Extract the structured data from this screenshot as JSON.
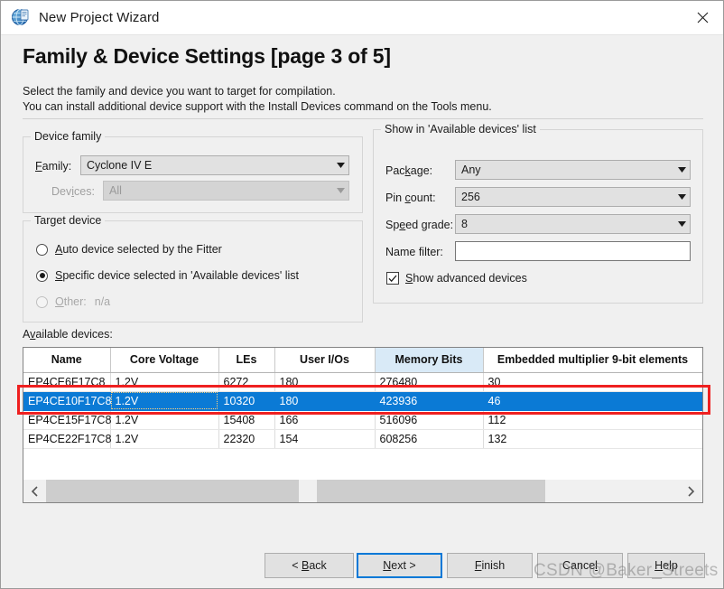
{
  "window": {
    "title": "New Project Wizard",
    "icon": "quartus-globe-icon",
    "close_label": "✕"
  },
  "header": {
    "page_title": "Family & Device Settings [page 3 of 5]",
    "description_line1": "Select the family and device you want to target for compilation.",
    "description_line2": "You can install additional device support with the Install Devices command on the Tools menu."
  },
  "device_family": {
    "legend": "Device family",
    "family_label": "Family:",
    "family_value": "Cyclone IV E",
    "devices_label": "Devices:",
    "devices_value": "All"
  },
  "target_device": {
    "legend": "Target device",
    "options": [
      {
        "label": "Auto device selected by the Fitter",
        "checked": false,
        "disabled": false
      },
      {
        "label": "Specific device selected in 'Available devices' list",
        "checked": true,
        "disabled": false
      },
      {
        "label": "Other:",
        "value": "n/a",
        "checked": false,
        "disabled": true
      }
    ]
  },
  "show_list": {
    "legend": "Show in 'Available devices' list",
    "package_label": "Package:",
    "package_value": "Any",
    "pin_count_label": "Pin count:",
    "pin_count_value": "256",
    "speed_grade_label": "Speed grade:",
    "speed_grade_value": "8",
    "name_filter_label": "Name filter:",
    "name_filter_value": "",
    "name_filter_placeholder": "",
    "show_advanced_label": "Show advanced devices",
    "show_advanced_checked": true
  },
  "available_devices": {
    "label": "Available devices:",
    "columns": [
      "Name",
      "Core Voltage",
      "LEs",
      "User I/Os",
      "Memory Bits",
      "Embedded multiplier 9-bit elements"
    ],
    "sorted_column": "Memory Bits",
    "rows": [
      {
        "name": "EP4CE6F17C8",
        "core_voltage": "1.2V",
        "les": "6272",
        "user_ios": "180",
        "memory_bits": "276480",
        "multipliers": "30",
        "selected": false
      },
      {
        "name": "EP4CE10F17C8",
        "core_voltage": "1.2V",
        "les": "10320",
        "user_ios": "180",
        "memory_bits": "423936",
        "multipliers": "46",
        "selected": true
      },
      {
        "name": "EP4CE15F17C8",
        "core_voltage": "1.2V",
        "les": "15408",
        "user_ios": "166",
        "memory_bits": "516096",
        "multipliers": "112",
        "selected": false
      },
      {
        "name": "EP4CE22F17C8",
        "core_voltage": "1.2V",
        "les": "22320",
        "user_ios": "154",
        "memory_bits": "608256",
        "multipliers": "132",
        "selected": false
      }
    ],
    "scroll_left_label": "‹",
    "scroll_right_label": "›"
  },
  "footer": {
    "back_label": "< Back",
    "next_label": "Next >",
    "finish_label": "Finish",
    "cancel_label": "Cancel",
    "help_label": "Help",
    "default_button": "Next >"
  },
  "watermark": {
    "text": "CSDN @Baker_Streets"
  },
  "colors": {
    "selection_blue": "#0b7ad5",
    "annotation_red": "#ef2020",
    "focus_blue": "#0078d7",
    "sorted_header": "#d9eaf7",
    "dialog_bg": "#f0f0f0"
  }
}
